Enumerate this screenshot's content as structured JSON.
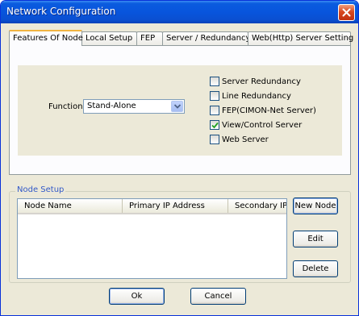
{
  "window": {
    "title": "Network Configuration"
  },
  "tabs": [
    {
      "label": "Features Of Node",
      "active": true
    },
    {
      "label": "Local Setup"
    },
    {
      "label": "FEP"
    },
    {
      "label": "Server / Redundancy"
    },
    {
      "label": "Web(Http) Server Setting"
    }
  ],
  "features": {
    "function_label": "Function",
    "function_value": "Stand-Alone",
    "options": [
      {
        "label": "Server Redundancy",
        "checked": false
      },
      {
        "label": "Line Redundancy",
        "checked": false
      },
      {
        "label": "FEP(CIMON-Net Server)",
        "checked": false
      },
      {
        "label": "View/Control Server",
        "checked": true
      },
      {
        "label": "Web Server",
        "checked": false
      }
    ]
  },
  "node_setup": {
    "title": "Node Setup",
    "columns": [
      "Node Name",
      "Primary IP Address",
      "Secondary IP A"
    ],
    "rows": [],
    "buttons": {
      "new_node": "New Node",
      "edit": "Edit",
      "delete": "Delete"
    }
  },
  "footer": {
    "ok": "Ok",
    "cancel": "Cancel"
  },
  "colors": {
    "titlebar": "#0855dd",
    "dialog_bg": "#ece9d8",
    "group_title": "#3259c8",
    "active_tab_accent": "#f1b441"
  },
  "icons": {
    "close": "close-icon",
    "dropdown": "chevron-down-icon",
    "check": "check-icon"
  }
}
